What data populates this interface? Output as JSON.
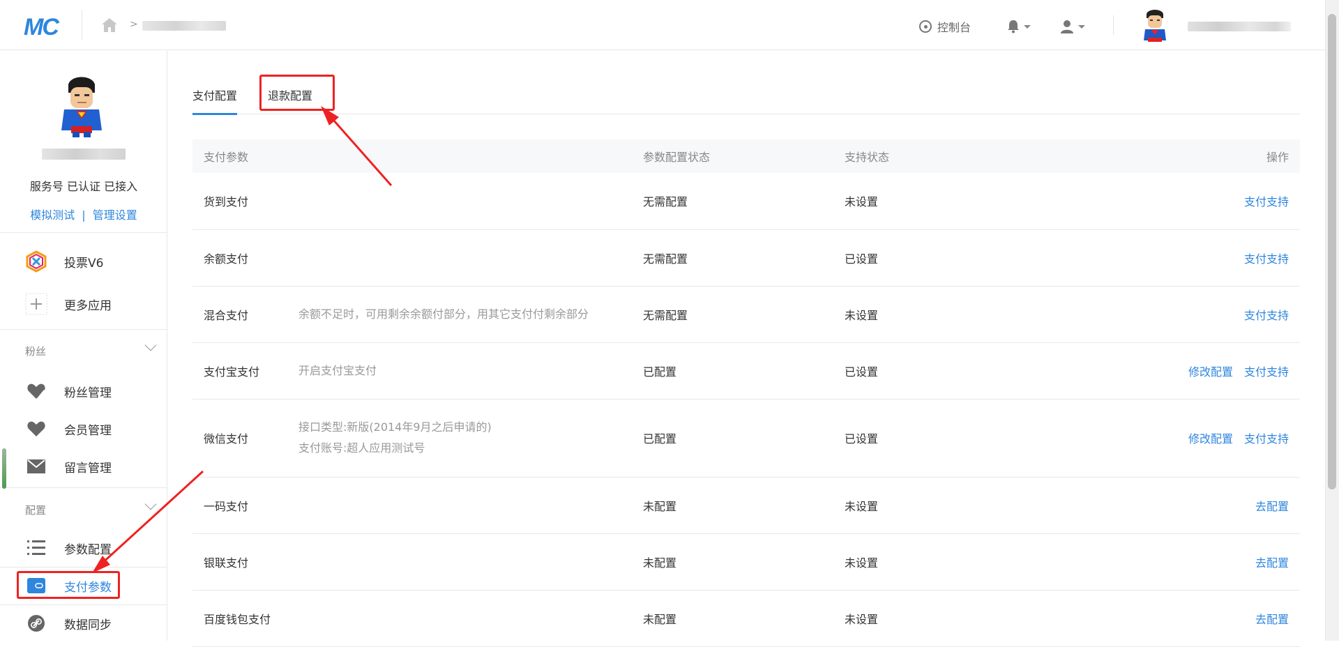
{
  "header": {
    "logo": "MC",
    "breadcrumb_sep": ">",
    "console_label": "控制台"
  },
  "sidebar": {
    "account_status": "服务号 已认证 已接入",
    "links": [
      "模拟测试",
      "管理设置"
    ],
    "link_sep": "|",
    "apps": [
      {
        "label": "投票V6",
        "icon": "vote-app-icon"
      },
      {
        "label": "更多应用",
        "icon": "plus-icon"
      }
    ],
    "sections": [
      {
        "title": "粉丝",
        "items": [
          {
            "label": "粉丝管理",
            "icon": "heart-edit-icon"
          },
          {
            "label": "会员管理",
            "icon": "heart-icon"
          },
          {
            "label": "留言管理",
            "icon": "mail-icon"
          }
        ]
      },
      {
        "title": "配置",
        "items": [
          {
            "label": "参数配置",
            "icon": "list-icon"
          },
          {
            "label": "支付参数",
            "icon": "wallet-icon",
            "active": true
          },
          {
            "label": "数据同步",
            "icon": "link-icon"
          }
        ]
      }
    ]
  },
  "tabs": [
    {
      "label": "支付配置",
      "active": true
    },
    {
      "label": "退款配置",
      "active": false
    }
  ],
  "table": {
    "headers": [
      "支付参数",
      "参数配置状态",
      "支持状态",
      "操作"
    ],
    "rows": [
      {
        "name": "货到支付",
        "desc": "",
        "desc2": "",
        "config": "无需配置",
        "support": "未设置",
        "actions": [
          "支付支持"
        ]
      },
      {
        "name": "余额支付",
        "desc": "",
        "desc2": "",
        "config": "无需配置",
        "support": "已设置",
        "actions": [
          "支付支持"
        ]
      },
      {
        "name": "混合支付",
        "desc": "余额不足时，可用剩余余额付部分，用其它支付付剩余部分",
        "desc2": "",
        "config": "无需配置",
        "support": "未设置",
        "actions": [
          "支付支持"
        ]
      },
      {
        "name": "支付宝支付",
        "desc": "开启支付宝支付",
        "desc2": "",
        "config": "已配置",
        "support": "已设置",
        "actions": [
          "修改配置",
          "支付支持"
        ]
      },
      {
        "name": "微信支付",
        "desc": "接口类型:新版(2014年9月之后申请的)",
        "desc2": "支付账号:超人应用测试号",
        "config": "已配置",
        "support": "已设置",
        "actions": [
          "修改配置",
          "支付支持"
        ]
      },
      {
        "name": "一码支付",
        "desc": "",
        "desc2": "",
        "config": "未配置",
        "support": "未设置",
        "actions": [
          "去配置"
        ]
      },
      {
        "name": "银联支付",
        "desc": "",
        "desc2": "",
        "config": "未配置",
        "support": "未设置",
        "actions": [
          "去配置"
        ]
      },
      {
        "name": "百度钱包支付",
        "desc": "",
        "desc2": "",
        "config": "未配置",
        "support": "未设置",
        "actions": [
          "去配置"
        ]
      }
    ]
  },
  "colors": {
    "accent": "#2e86de",
    "annotation": "#e22222"
  }
}
